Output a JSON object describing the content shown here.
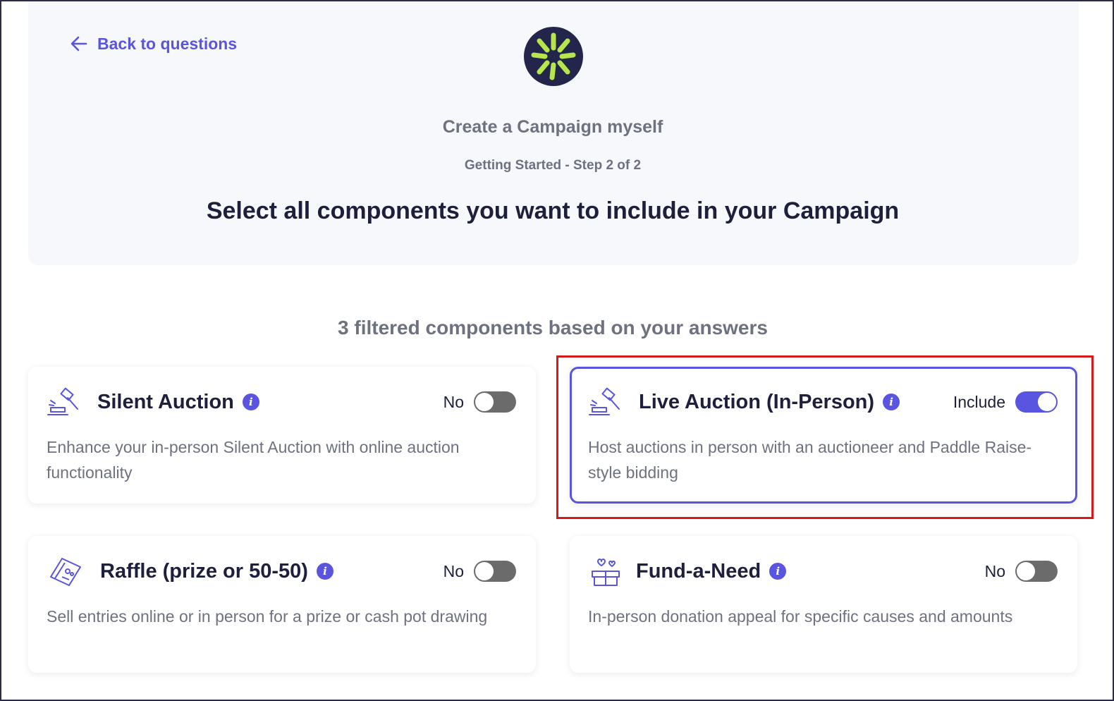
{
  "header": {
    "back_label": "Back to questions",
    "subtitle": "Create a Campaign myself",
    "step": "Getting Started - Step 2 of 2",
    "headline": "Select all components you want to include in your Campaign"
  },
  "filter_summary": "3 filtered components based on your answers",
  "components": [
    {
      "title": "Silent Auction",
      "toggle_label": "No",
      "toggle_on": false,
      "description": "Enhance your in-person Silent Auction with online auction functionality",
      "icon": "gavel-icon"
    },
    {
      "title": "Live Auction (In-Person)",
      "toggle_label": "Include",
      "toggle_on": true,
      "description": "Host auctions in person with an auctioneer and Paddle Raise-style bidding",
      "icon": "gavel-icon"
    },
    {
      "title": "Raffle (prize or 50-50)",
      "toggle_label": "No",
      "toggle_on": false,
      "description": "Sell entries online or in person for a prize or cash pot drawing",
      "icon": "ticket-icon"
    },
    {
      "title": "Fund-a-Need",
      "toggle_label": "No",
      "toggle_on": false,
      "description": "In-person donation appeal for specific causes and amounts",
      "icon": "gift-box-hearts-icon"
    }
  ],
  "colors": {
    "accent": "#5a55e0",
    "heading": "#1e1f3d",
    "muted": "#6e7180",
    "logo_bg": "#23264a",
    "logo_mark": "#b5e64b",
    "highlight": "#d41a1a"
  }
}
